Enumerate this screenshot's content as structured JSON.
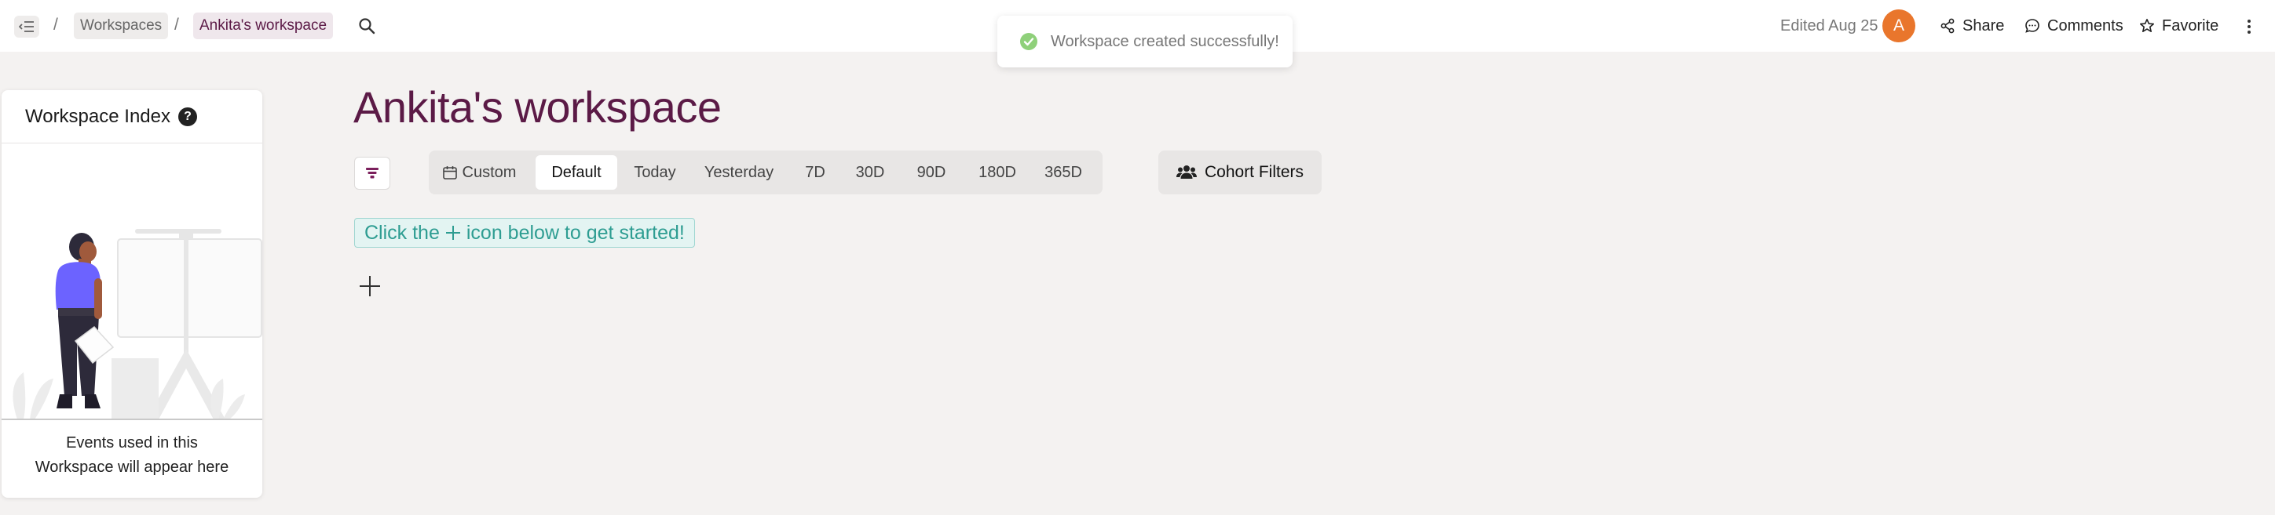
{
  "topbar": {
    "breadcrumb": [
      {
        "label": "Workspaces"
      },
      {
        "label": "Ankita's workspace"
      }
    ],
    "separator": "/",
    "edited": "Edited Aug 25",
    "avatar_initial": "A",
    "avatar_color": "#e9762c",
    "share_label": "Share",
    "comments_label": "Comments",
    "favorite_label": "Favorite"
  },
  "toast": {
    "message": "Workspace created successfully!",
    "icon": "check-circle-icon",
    "color": "#8fd07a"
  },
  "index_panel": {
    "title": "Workspace Index",
    "help_glyph": "?",
    "empty_text": "Events used in this Workspace will appear here"
  },
  "main": {
    "title": "Ankita's workspace",
    "title_color": "#5b1a46",
    "date_ranges": [
      {
        "label": "Custom",
        "icon": "calendar-icon"
      },
      {
        "label": "Default",
        "active": true
      },
      {
        "label": "Today"
      },
      {
        "label": "Yesterday"
      },
      {
        "label": "7D"
      },
      {
        "label": "30D"
      },
      {
        "label": "90D"
      },
      {
        "label": "180D"
      },
      {
        "label": "365D"
      }
    ],
    "cohort_filters_label": "Cohort Filters",
    "hint_before": "Click the",
    "hint_after": "icon below to get started!",
    "hint_color": "#2e9d92"
  }
}
